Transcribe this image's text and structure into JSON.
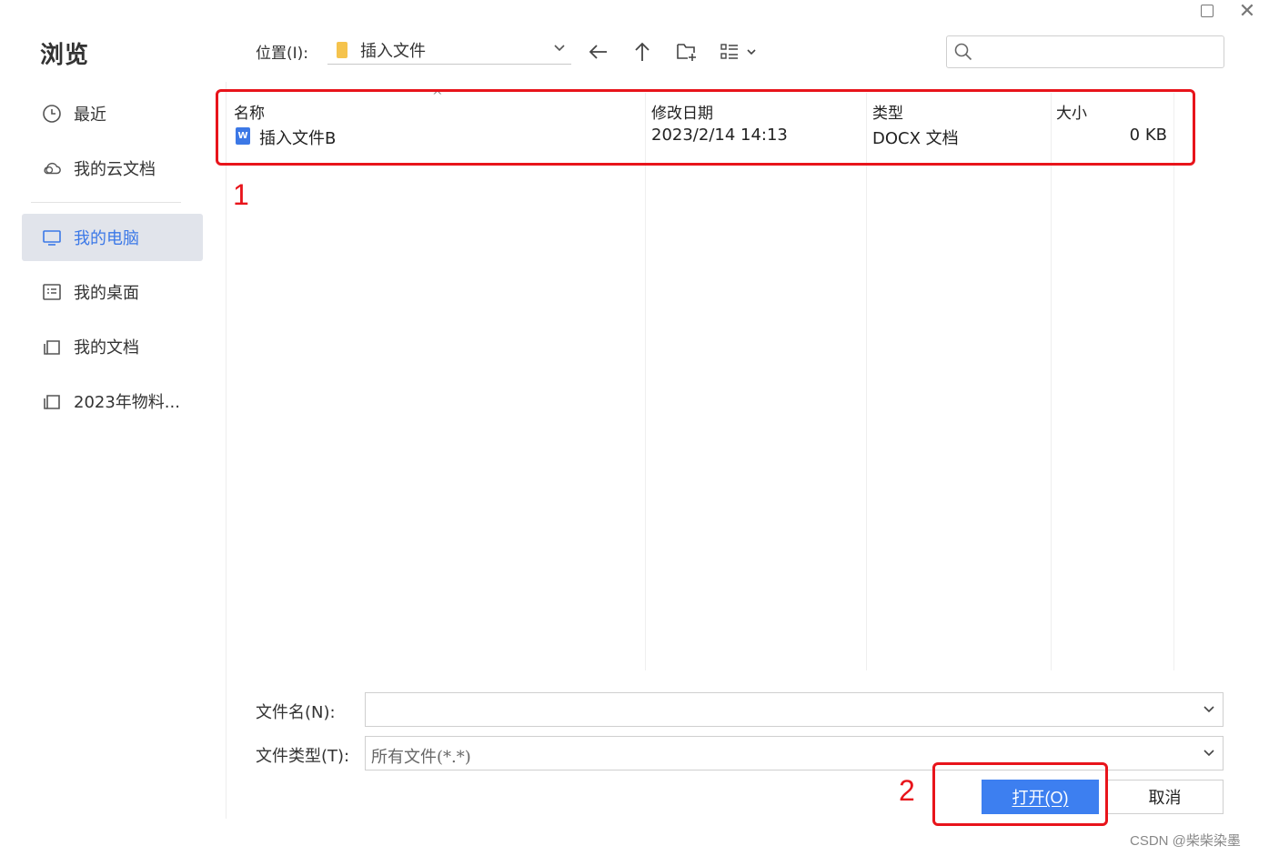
{
  "sidebar": {
    "title": "浏览",
    "items": [
      {
        "label": "最近",
        "icon": "clock-icon"
      },
      {
        "label": "我的云文档",
        "icon": "cloud-icon"
      },
      {
        "label": "我的电脑",
        "icon": "monitor-icon",
        "active": true
      },
      {
        "label": "我的桌面",
        "icon": "desktop-icon"
      },
      {
        "label": "我的文档",
        "icon": "folder-icon"
      },
      {
        "label": "2023年物料...",
        "icon": "folder-icon"
      }
    ]
  },
  "toolbar": {
    "location_label": "位置(I):",
    "location_value": "插入文件",
    "search_placeholder": ""
  },
  "file_list": {
    "columns": [
      "名称",
      "修改日期",
      "类型",
      "大小"
    ],
    "rows": [
      {
        "name": "插入文件B",
        "modified": "2023/2/14 14:13",
        "type": "DOCX 文档",
        "size": "0 KB",
        "icon": "docx-icon"
      }
    ]
  },
  "form": {
    "filename_label": "文件名(N):",
    "filename_value": "",
    "filetype_label": "文件类型(T):",
    "filetype_value": "所有文件(*.*)",
    "open_label": "打开(O)",
    "cancel_label": "取消"
  },
  "annotations": {
    "one": "1",
    "two": "2"
  },
  "watermark": "CSDN @柴柴染墨",
  "colors": {
    "accent": "#3d7ff0",
    "annotation": "#e8141b",
    "active_bg": "#e1e4eb"
  }
}
